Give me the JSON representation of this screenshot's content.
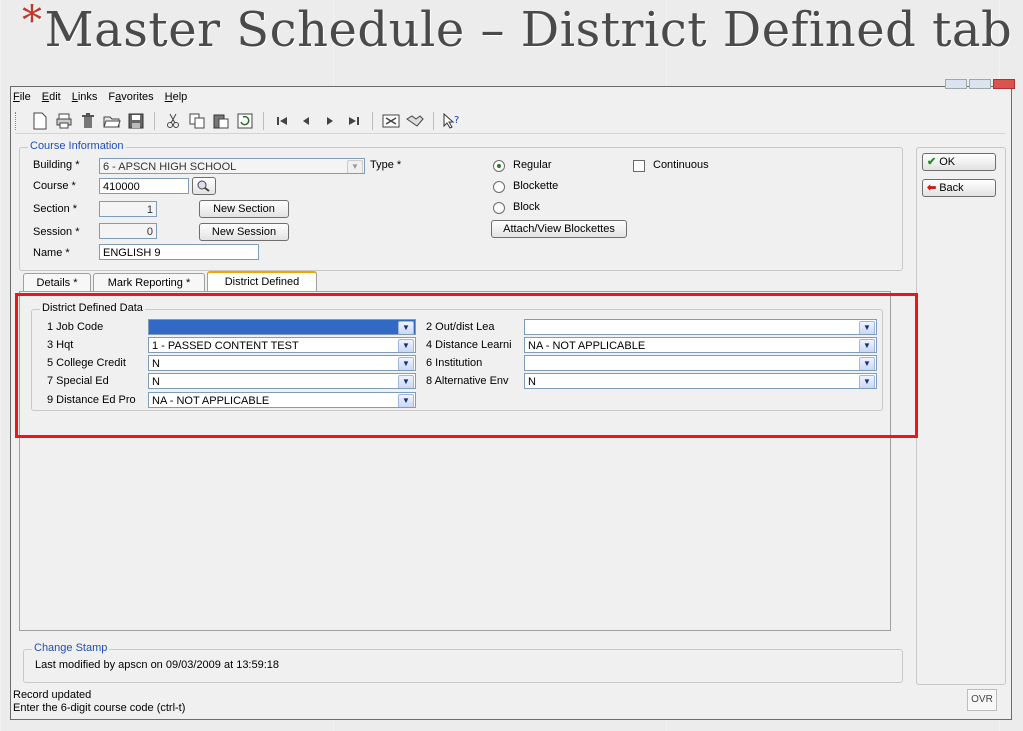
{
  "slide": {
    "bullet": "*",
    "title": "Master Schedule – District Defined tab"
  },
  "menu": {
    "items": [
      {
        "key": "F",
        "rest": "ile"
      },
      {
        "key": "E",
        "rest": "dit"
      },
      {
        "key": "L",
        "rest": "inks"
      },
      {
        "pre": "F",
        "key": "a",
        "rest": "vorites"
      },
      {
        "key": "H",
        "rest": "elp"
      }
    ]
  },
  "toolbar": {
    "icons": [
      "new-icon",
      "print-icon",
      "delete-icon",
      "open-icon",
      "save-icon",
      "cut-icon",
      "copy-icon",
      "paste-icon",
      "refresh-icon",
      "first-record-icon",
      "prev-record-icon",
      "next-record-icon",
      "last-record-icon",
      "report-icon",
      "handshake-icon",
      "help-pointer-icon"
    ]
  },
  "course_info": {
    "group_label": "Course Information",
    "building_label": "Building *",
    "building_value": "6 - APSCN HIGH SCHOOL",
    "type_label": "Type *",
    "course_label": "Course *",
    "course_value": "410000",
    "section_label": "Section *",
    "section_value": "1",
    "new_section_label": "New Section",
    "session_label": "Session *",
    "session_value": "0",
    "new_session_label": "New Session",
    "name_label": "Name *",
    "name_value": "ENGLISH 9",
    "radio_regular": "Regular",
    "radio_blockette": "Blockette",
    "radio_block": "Block",
    "continuous_label": "Continuous",
    "attach_label": "Attach/View Blockettes",
    "selected_type": "Regular"
  },
  "side": {
    "ok_label": "OK",
    "back_label": "Back"
  },
  "tabs": [
    {
      "label": "Details *"
    },
    {
      "label": "Mark Reporting *"
    },
    {
      "label": "District Defined"
    }
  ],
  "district": {
    "group_label": "District Defined Data",
    "fields": [
      {
        "label": "1 Job Code",
        "value": ""
      },
      {
        "label": "2 Out/dist Lea",
        "value": ""
      },
      {
        "label": "3 Hqt",
        "value": "1 - PASSED CONTENT TEST"
      },
      {
        "label": "4 Distance Learni",
        "value": "NA - NOT APPLICABLE"
      },
      {
        "label": "5 College Credit",
        "value": "N"
      },
      {
        "label": "6 Institution",
        "value": ""
      },
      {
        "label": "7 Special Ed",
        "value": "N"
      },
      {
        "label": "8 Alternative Env",
        "value": "N"
      },
      {
        "label": "9 Distance Ed Pro",
        "value": "NA - NOT APPLICABLE"
      }
    ]
  },
  "change_stamp": {
    "group_label": "Change Stamp",
    "text": "Last modified by apscn on 09/03/2009 at 13:59:18"
  },
  "status": {
    "line1": "Record updated",
    "line2": "Enter the 6-digit course code (ctrl-t)",
    "ovr": "OVR"
  }
}
